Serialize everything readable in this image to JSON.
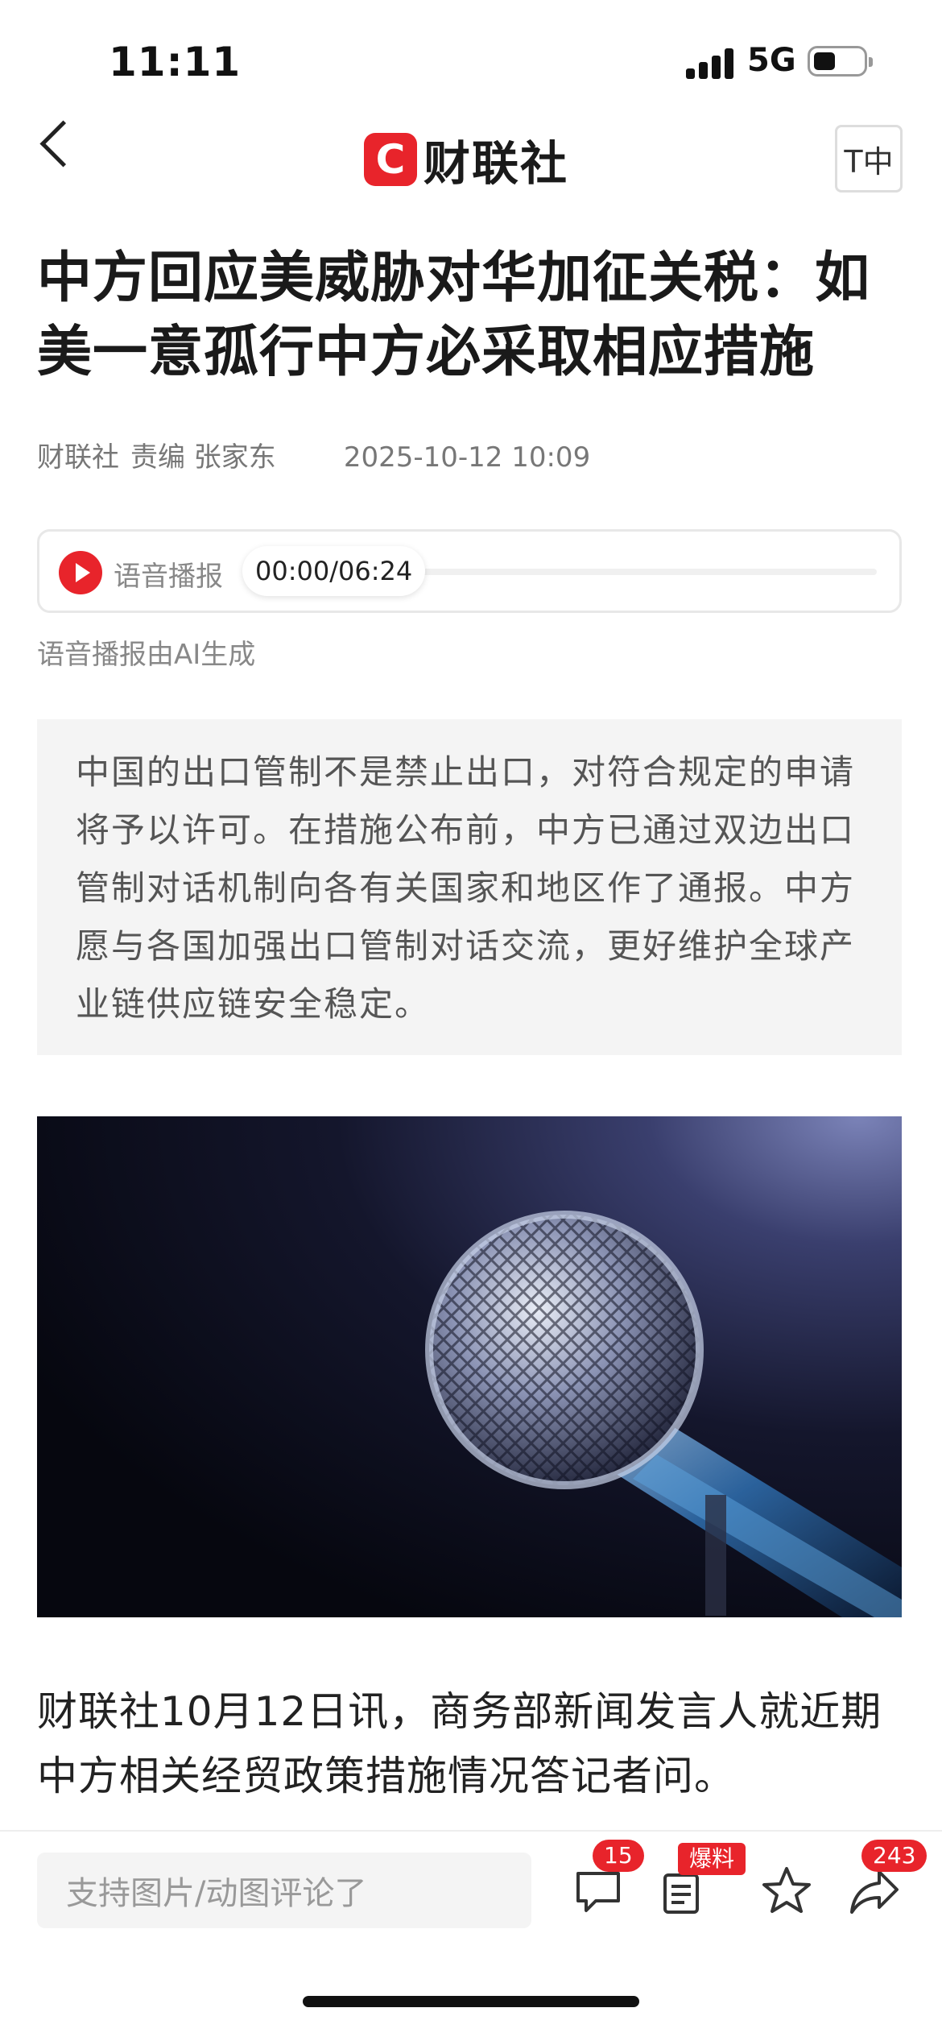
{
  "status_bar": {
    "time": "11:11",
    "network": "5G"
  },
  "nav": {
    "logo_letter": "C",
    "logo_text": "财联社",
    "font_button": "T中"
  },
  "article": {
    "title": "中方回应美威胁对华加征关税：如美一意孤行中方必采取相应措施",
    "source": "财联社",
    "editor": "责编 张家东",
    "date": "2025-10-12 10:09"
  },
  "audio": {
    "label": "语音播报",
    "time": "00:00/06:24",
    "progress": 0,
    "caption": "语音播报由AI生成"
  },
  "quote": "中国的出口管制不是禁止出口，对符合规定的申请将予以许可。在措施公布前，中方已通过双边出口管制对话机制向各有关国家和地区作了通报。中方愿与各国加强出口管制对话交流，更好维护全球产业链供应链安全稳定。",
  "body_text": "财联社10月12日讯，商务部新闻发言人就近期中方相关经贸政策措施情况答记者问。",
  "bottom_bar": {
    "comment_placeholder": "支持图片/动图评论了",
    "comment_count": "15",
    "report_badge": "爆料",
    "share_count": "243"
  },
  "colors": {
    "brand_red": "#e8242b"
  }
}
